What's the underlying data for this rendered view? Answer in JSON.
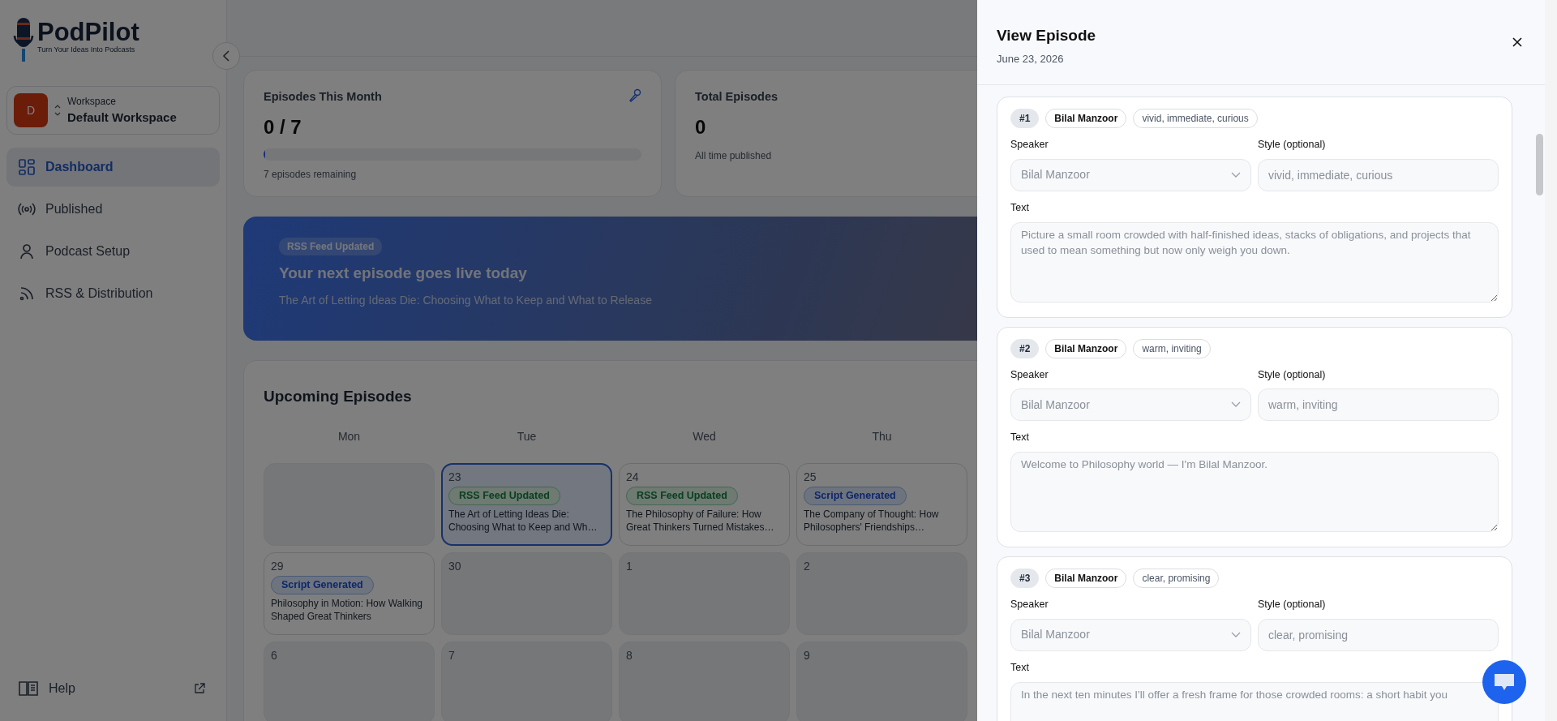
{
  "sidebar": {
    "logo": {
      "name": "PodPilot",
      "tagline": "Turn Your Ideas Into Podcasts"
    },
    "workspace": {
      "avatar": "D",
      "label": "Workspace",
      "name": "Default Workspace"
    },
    "items": [
      {
        "label": "Dashboard",
        "selected": true
      },
      {
        "label": "Published",
        "selected": false
      },
      {
        "label": "Podcast Setup",
        "selected": false
      },
      {
        "label": "RSS & Distribution",
        "selected": false
      }
    ],
    "help": "Help"
  },
  "stats": [
    {
      "title": "Episodes This Month",
      "value": "0 / 7",
      "level": 0,
      "note": "7 episodes remaining"
    },
    {
      "title": "Total Episodes",
      "value": "0",
      "note": "All time published"
    }
  ],
  "banner": {
    "badge": "RSS Feed Updated",
    "title": "Your next episode goes live today",
    "subtitle": "The Art of Letting Ideas Die: Choosing What to Keep and What to Release"
  },
  "calendar": {
    "title": "Upcoming Episodes",
    "weekdays": [
      "Mon",
      "Tue",
      "Wed",
      "Thu"
    ],
    "weeks": [
      [
        {
          "selected": false
        },
        {
          "day": "23",
          "selected": true,
          "episode": {
            "status": "RSS Feed Updated",
            "kind": "rss",
            "title": "The Art of Letting Ideas Die: Choosing What to Keep and Wh…"
          }
        },
        {
          "day": "24",
          "selected": false,
          "episode": {
            "status": "RSS Feed Updated",
            "kind": "rss",
            "title": "The Philosophy of Failure: How Great Thinkers Turned Mistakes…"
          }
        },
        {
          "day": "25",
          "selected": false,
          "episode": {
            "status": "Script Generated",
            "kind": "script",
            "title": "The Company of Thought: How Philosophers' Friendships…"
          }
        }
      ],
      [
        {
          "day": "29",
          "selected": false,
          "episode": {
            "status": "Script Generated",
            "kind": "script",
            "title": "Philosophy in Motion: How Walking Shaped Great Thinkers"
          }
        },
        {
          "day": "30",
          "selected": false
        },
        {
          "day": "1",
          "selected": false
        },
        {
          "day": "2",
          "selected": false
        }
      ],
      [
        {
          "day": "6",
          "selected": false
        },
        {
          "day": "7",
          "selected": false
        },
        {
          "day": "8",
          "selected": false
        },
        {
          "day": "9",
          "selected": false
        }
      ]
    ]
  },
  "drawer": {
    "title": "View Episode",
    "date": "June 23, 2026",
    "segments": [
      {
        "number": "#1",
        "speaker_chip": "Bilal Manzoor",
        "style_chip": "vivid, immediate, curious",
        "speaker_label": "Speaker",
        "speaker_value": "Bilal Manzoor",
        "style_label": "Style (optional)",
        "style_value": "vivid, immediate, curious",
        "text_label": "Text",
        "text_value": "Picture a small room crowded with half-finished ideas, stacks of obligations, and projects that used to mean something but now only weigh you down."
      },
      {
        "number": "#2",
        "speaker_chip": "Bilal Manzoor",
        "style_chip": "warm, inviting",
        "speaker_label": "Speaker",
        "speaker_value": "Bilal Manzoor",
        "style_label": "Style (optional)",
        "style_value": "warm, inviting",
        "text_label": "Text",
        "text_value": "Welcome to Philosophy world — I'm Bilal Manzoor."
      },
      {
        "number": "#3",
        "speaker_chip": "Bilal Manzoor",
        "style_chip": "clear, promising",
        "speaker_label": "Speaker",
        "speaker_value": "Bilal Manzoor",
        "style_label": "Style (optional)",
        "style_value": "clear, promising",
        "text_label": "Text",
        "text_value": "In the next ten minutes I'll offer a fresh frame for those crowded rooms: a short habit you"
      }
    ]
  }
}
